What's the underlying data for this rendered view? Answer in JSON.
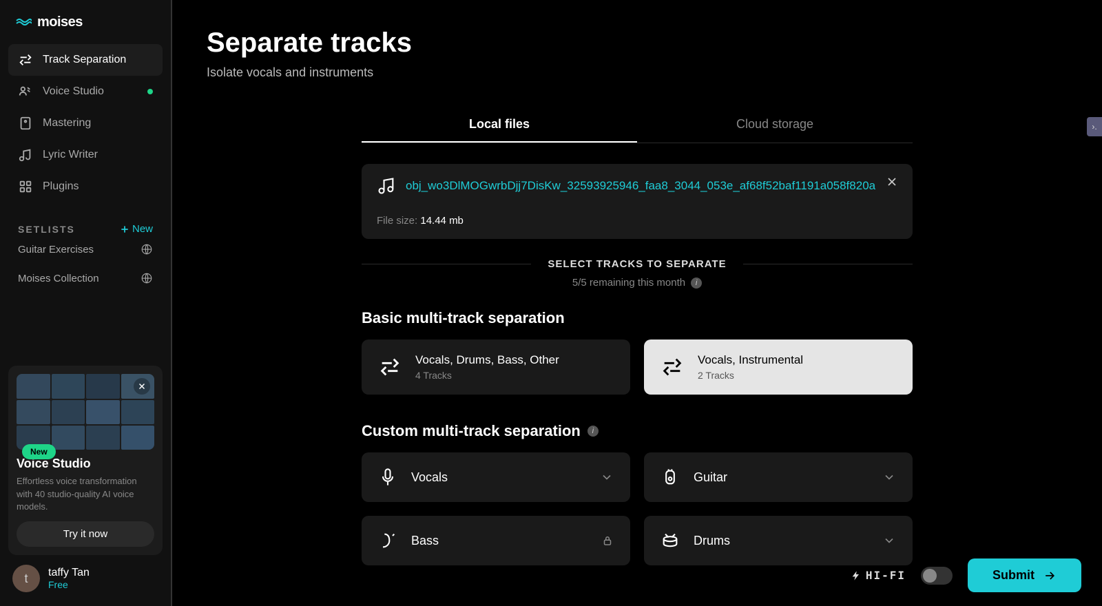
{
  "brand": "moises",
  "nav": {
    "items": [
      {
        "label": "Track Separation",
        "active": true,
        "icon": "separate"
      },
      {
        "label": "Voice Studio",
        "active": false,
        "icon": "voice",
        "badge": true
      },
      {
        "label": "Mastering",
        "active": false,
        "icon": "mastering"
      },
      {
        "label": "Lyric Writer",
        "active": false,
        "icon": "lyric"
      },
      {
        "label": "Plugins",
        "active": false,
        "icon": "plugins"
      }
    ]
  },
  "setlists": {
    "header": "SETLISTS",
    "new_label": "New",
    "items": [
      {
        "label": "Guitar Exercises"
      },
      {
        "label": "Moises Collection"
      }
    ]
  },
  "promo": {
    "badge": "New",
    "title": "Voice Studio",
    "desc": "Effortless voice transformation with 40 studio-quality AI voice models.",
    "btn": "Try it now"
  },
  "user": {
    "initial": "t",
    "name": "taffy Tan",
    "plan": "Free"
  },
  "page": {
    "title": "Separate tracks",
    "subtitle": "Isolate vocals and instruments"
  },
  "tabs": {
    "local": "Local files",
    "cloud": "Cloud storage"
  },
  "file": {
    "name": "obj_wo3DlMOGwrbDjj7DisKw_32593925946_faa8_3044_053e_af68f52baf1191a058f820a",
    "size_label": "File size: ",
    "size_value": "14.44 mb"
  },
  "section_separate": "SELECT TRACKS TO SEPARATE",
  "remaining": "5/5 remaining this month",
  "basic": {
    "title": "Basic multi-track separation",
    "options": [
      {
        "title": "Vocals, Drums, Bass, Other",
        "sub": "4 Tracks"
      },
      {
        "title": "Vocals, Instrumental",
        "sub": "2 Tracks"
      }
    ]
  },
  "custom": {
    "title": "Custom multi-track separation",
    "items": [
      {
        "label": "Vocals",
        "icon": "mic",
        "locked": false
      },
      {
        "label": "Guitar",
        "icon": "guitar",
        "locked": false
      },
      {
        "label": "Bass",
        "icon": "bass",
        "locked": true
      },
      {
        "label": "Drums",
        "icon": "drums",
        "locked": false
      }
    ]
  },
  "footer": {
    "hifi": "HI-FI",
    "submit": "Submit"
  }
}
